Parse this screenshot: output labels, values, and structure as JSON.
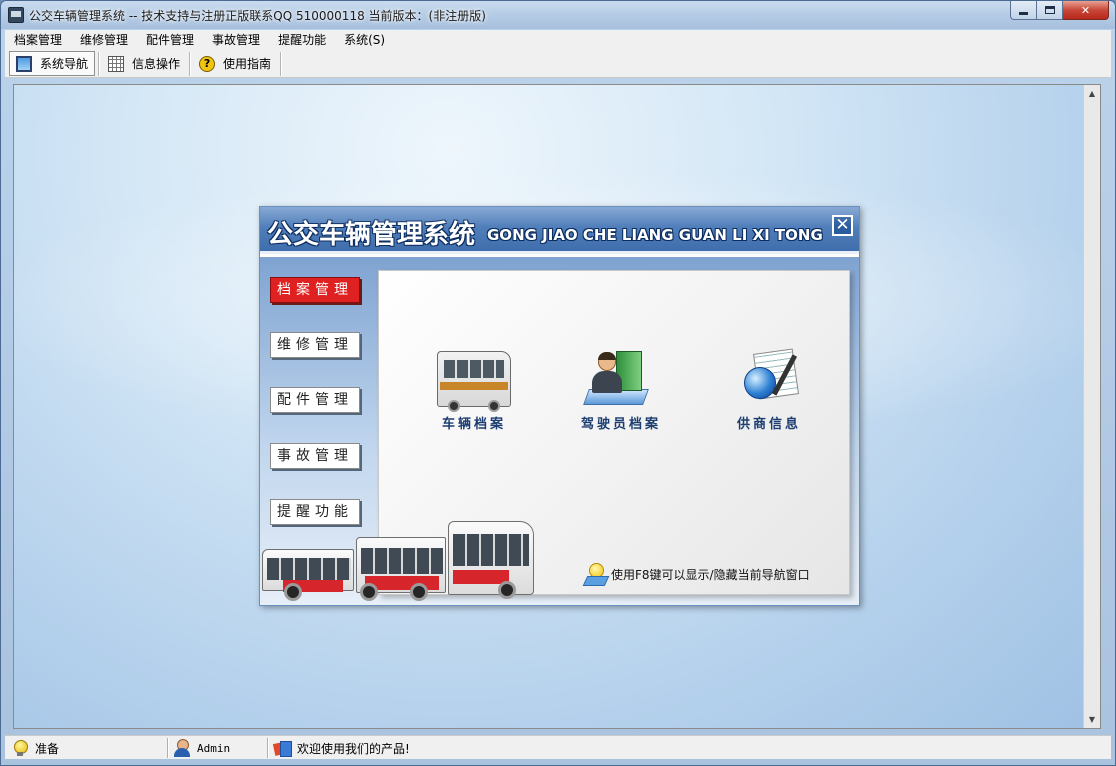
{
  "window": {
    "title": "公交车辆管理系统 -- 技术支持与注册正版联系QQ 510000118    当前版本：(非注册版)",
    "app_icon": "bus-app-icon",
    "controls": [
      "minimize",
      "maximize",
      "close"
    ]
  },
  "menubar": {
    "items": [
      "档案管理",
      "维修管理",
      "配件管理",
      "事故管理",
      "提醒功能",
      "系统(S)"
    ]
  },
  "toolbar": {
    "buttons": [
      {
        "label": "系统导航",
        "icon": "monitor-icon",
        "active": true
      },
      {
        "label": "信息操作",
        "icon": "grid-icon",
        "active": false
      },
      {
        "label": "使用指南",
        "icon": "help-icon",
        "active": false
      }
    ]
  },
  "nav_panel": {
    "title_cn": "公交车辆管理系统",
    "title_en": "GONG JIAO CHE LIANG GUAN LI XI TONG",
    "close_glyph": "✕",
    "side_menu": [
      {
        "label": "档案管理",
        "active": true
      },
      {
        "label": "维修管理",
        "active": false
      },
      {
        "label": "配件管理",
        "active": false
      },
      {
        "label": "事故管理",
        "active": false
      },
      {
        "label": "提醒功能",
        "active": false
      }
    ],
    "functions": [
      {
        "label": "车辆档案",
        "icon": "bus-icon"
      },
      {
        "label": "驾驶员档案",
        "icon": "driver-icon"
      },
      {
        "label": "供商信息",
        "icon": "supplier-icon"
      }
    ],
    "tip": "使用F8键可以显示/隐藏当前导航窗口",
    "accent_active": "#e02121",
    "header_color": "#4a78b6"
  },
  "statusbar": {
    "ready": "准备",
    "user": "Admin",
    "welcome": "欢迎使用我们的产品!"
  }
}
